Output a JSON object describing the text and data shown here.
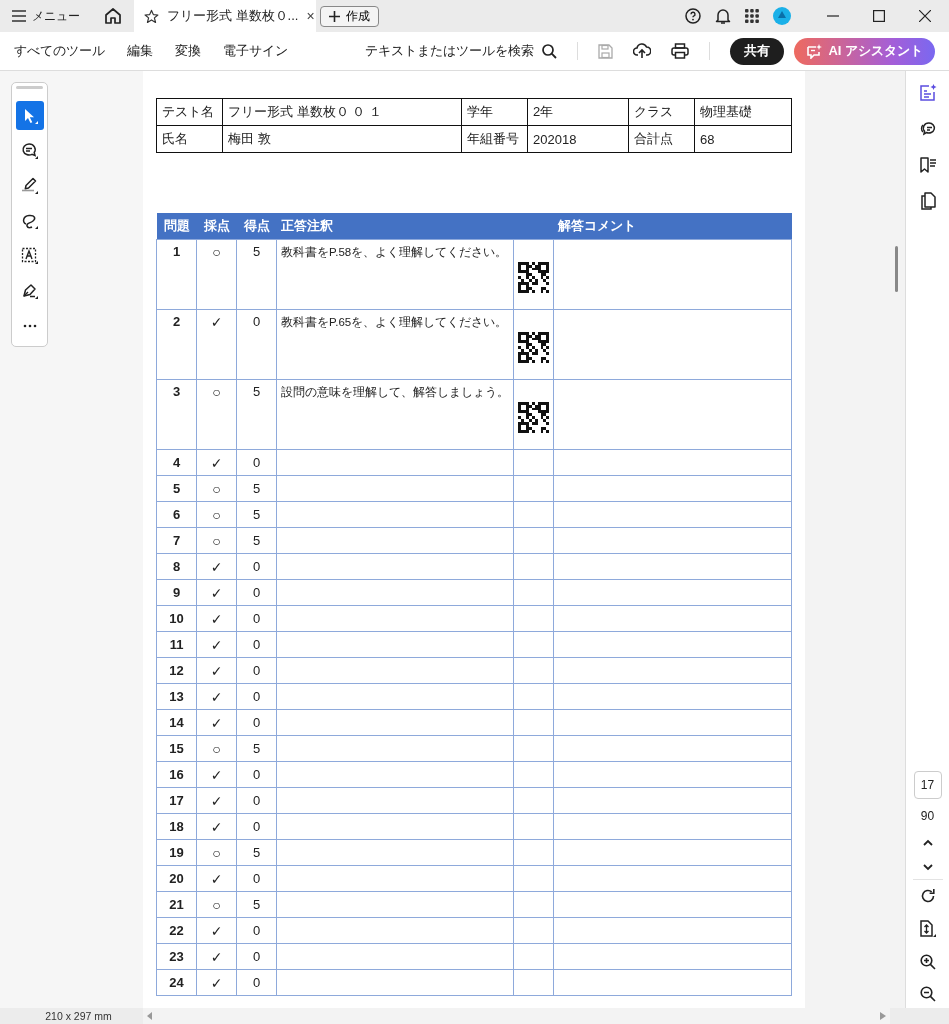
{
  "title_bar": {
    "menu": "メニュー",
    "tab": {
      "title": "フリー形式 単数枚０...",
      "close": "×",
      "selected": true
    },
    "new_button": "作成"
  },
  "toolbar": {
    "menus": [
      "すべてのツール",
      "編集",
      "変換",
      "電子サイン"
    ],
    "search": "テキストまたはツールを検索",
    "share": "共有",
    "ai": "AI アシスタント"
  },
  "tools": [
    {
      "kind": "select",
      "selected": true
    },
    {
      "kind": "comment",
      "selected": false
    },
    {
      "kind": "highlight",
      "selected": false
    },
    {
      "kind": "draw",
      "selected": false
    },
    {
      "kind": "text",
      "selected": false
    },
    {
      "kind": "sign",
      "selected": false
    },
    {
      "kind": "more",
      "selected": false
    }
  ],
  "info": [
    [
      {
        "label": "テスト名",
        "value": "フリー形式 単数枚０ ０ １"
      },
      {
        "label": "学年",
        "value": "2年"
      },
      {
        "label": "クラス",
        "value": "物理基礎"
      }
    ],
    [
      {
        "label": "氏名",
        "value": "梅田 敦"
      },
      {
        "label": "年組番号",
        "value": "202018"
      },
      {
        "label": "合計点",
        "value": "68"
      }
    ]
  ],
  "score_table": {
    "columns": [
      "問題",
      "採点",
      "得点",
      "正答注釈",
      "解答コメント"
    ],
    "rows": [
      {
        "no": "1",
        "mark": "○",
        "score": "5",
        "note": "教科書をP.58を、よく理解してください。",
        "qr": true
      },
      {
        "no": "2",
        "mark": "✓",
        "score": "0",
        "note": "教科書をP.65を、よく理解してください。",
        "qr": true
      },
      {
        "no": "3",
        "mark": "○",
        "score": "5",
        "note": "設問の意味を理解して、解答しましょう。",
        "qr": true
      },
      {
        "no": "4",
        "mark": "✓",
        "score": "0",
        "qr": false
      },
      {
        "no": "5",
        "mark": "○",
        "score": "5",
        "qr": false
      },
      {
        "no": "6",
        "mark": "○",
        "score": "5",
        "qr": false
      },
      {
        "no": "7",
        "mark": "○",
        "score": "5",
        "qr": false
      },
      {
        "no": "8",
        "mark": "✓",
        "score": "0",
        "qr": false
      },
      {
        "no": "9",
        "mark": "✓",
        "score": "0",
        "qr": false
      },
      {
        "no": "10",
        "mark": "✓",
        "score": "0",
        "qr": false
      },
      {
        "no": "11",
        "mark": "✓",
        "score": "0",
        "qr": false
      },
      {
        "no": "12",
        "mark": "✓",
        "score": "0",
        "qr": false
      },
      {
        "no": "13",
        "mark": "✓",
        "score": "0",
        "qr": false
      },
      {
        "no": "14",
        "mark": "✓",
        "score": "0",
        "qr": false
      },
      {
        "no": "15",
        "mark": "○",
        "score": "5",
        "qr": false
      },
      {
        "no": "16",
        "mark": "✓",
        "score": "0",
        "qr": false
      },
      {
        "no": "17",
        "mark": "✓",
        "score": "0",
        "qr": false
      },
      {
        "no": "18",
        "mark": "✓",
        "score": "0",
        "qr": false
      },
      {
        "no": "19",
        "mark": "○",
        "score": "5",
        "qr": false
      },
      {
        "no": "20",
        "mark": "✓",
        "score": "0",
        "qr": false
      },
      {
        "no": "21",
        "mark": "○",
        "score": "5",
        "qr": false
      },
      {
        "no": "22",
        "mark": "✓",
        "score": "0",
        "qr": false
      },
      {
        "no": "23",
        "mark": "✓",
        "score": "0",
        "qr": false
      },
      {
        "no": "24",
        "mark": "✓",
        "score": "0",
        "qr": false
      }
    ]
  },
  "right_panel": [
    {
      "kind": "ai",
      "selected": true
    },
    {
      "kind": "comments",
      "selected": false
    },
    {
      "kind": "bookmarks",
      "selected": false
    },
    {
      "kind": "pages",
      "selected": false
    }
  ],
  "page": {
    "current": "17",
    "total": "90"
  },
  "status_bar": {
    "page_size": "210 x 297 mm"
  }
}
